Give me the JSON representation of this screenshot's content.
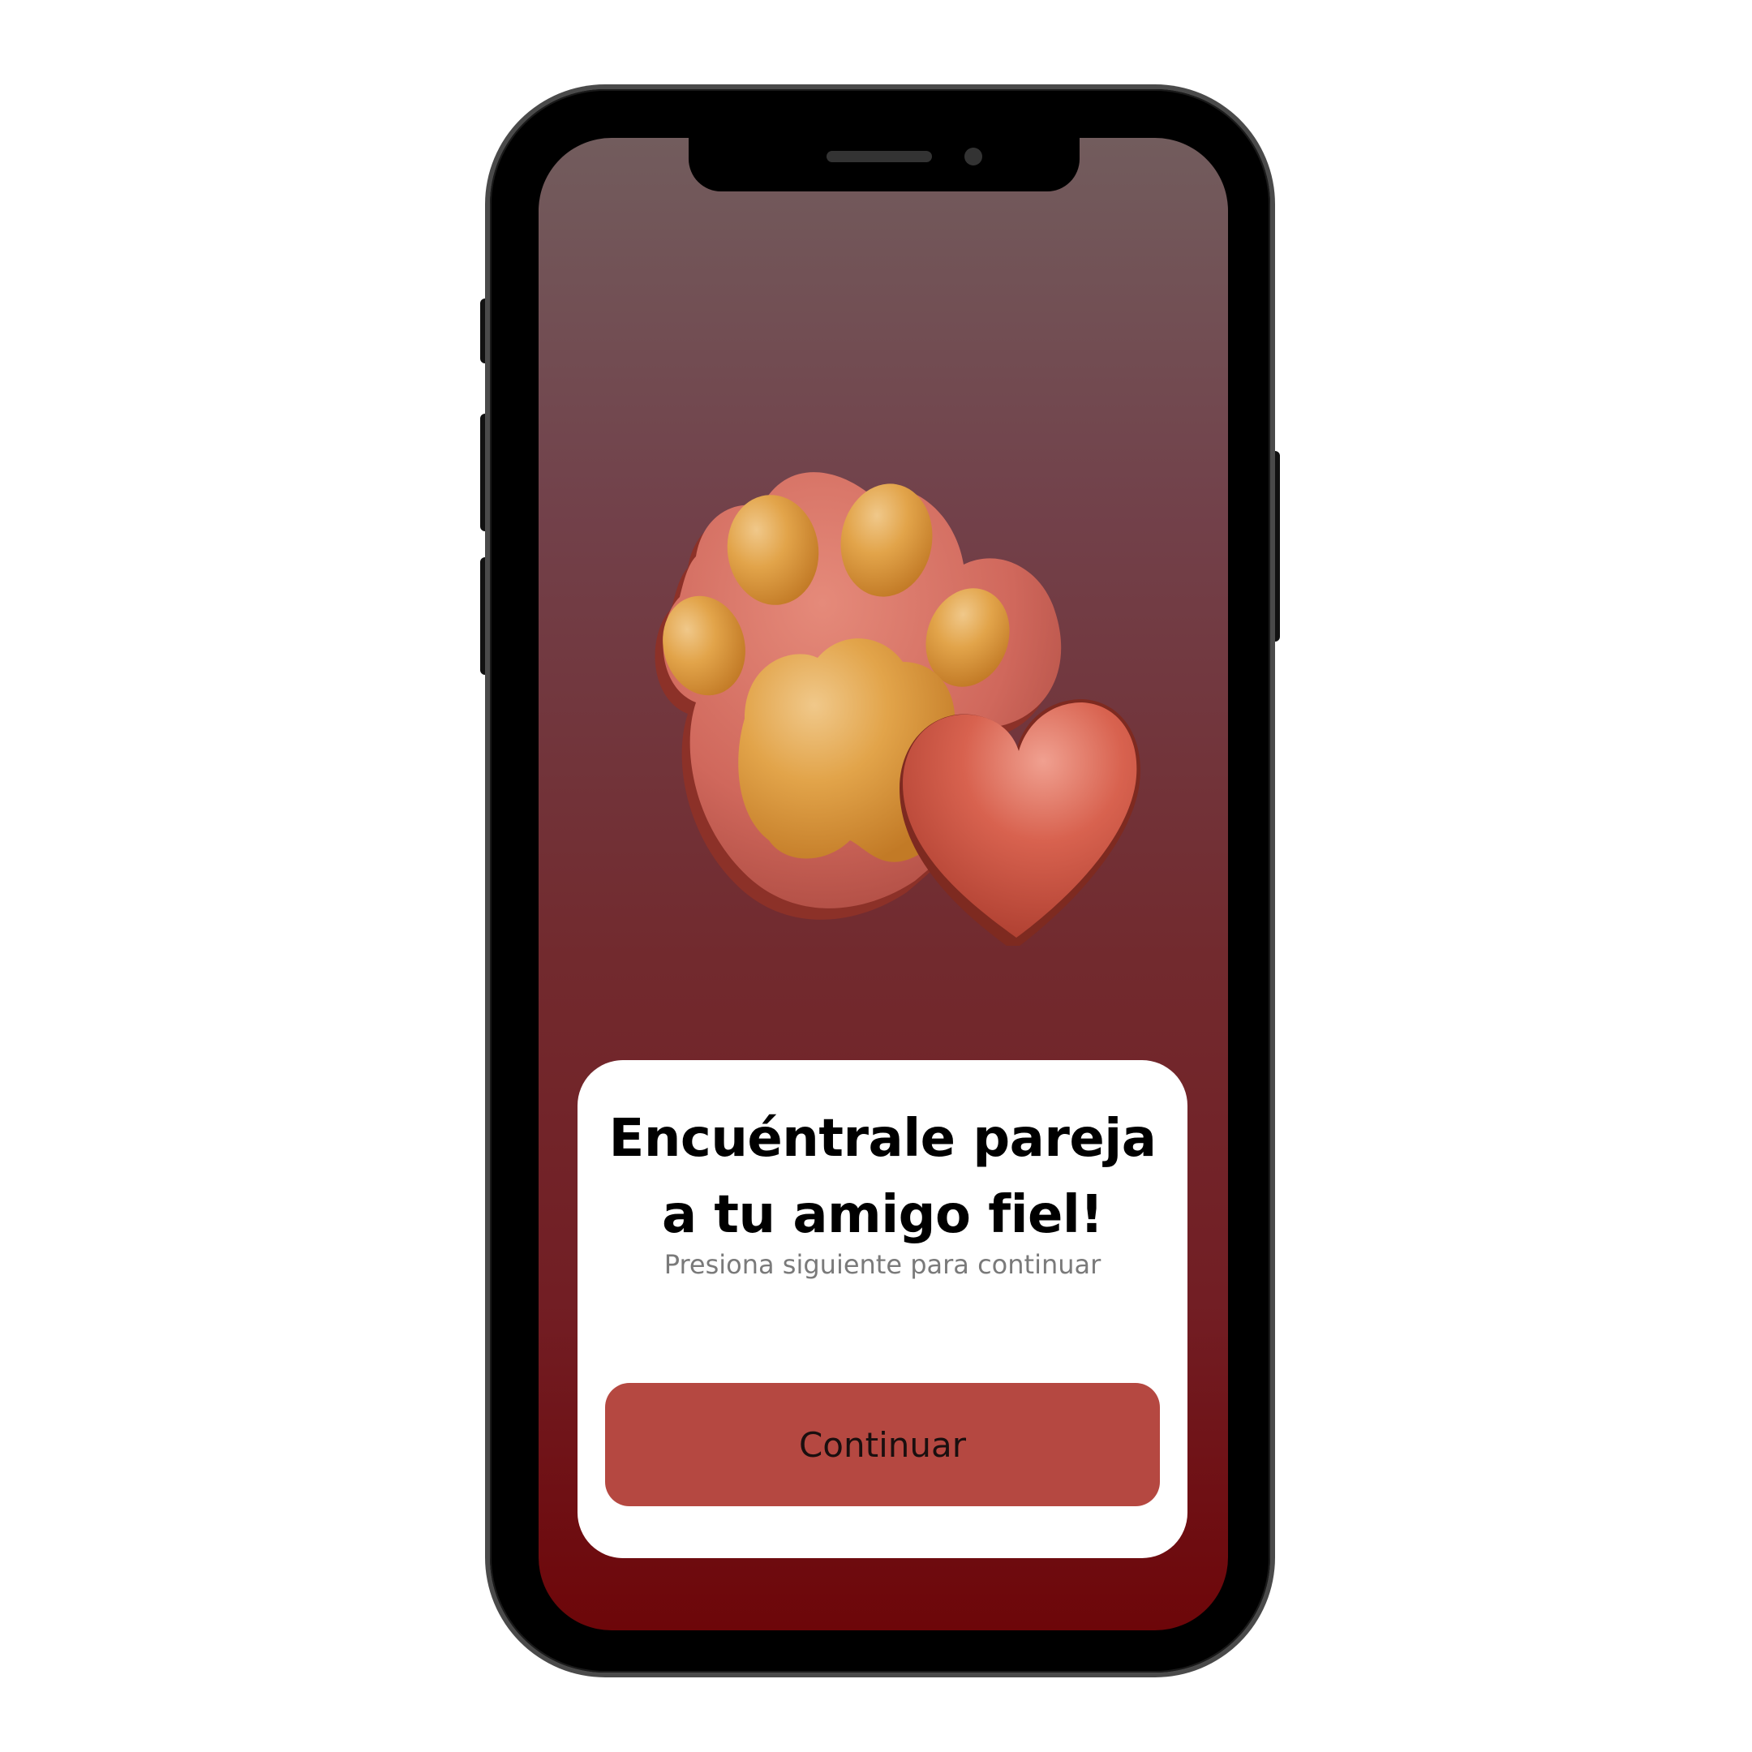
{
  "onboarding": {
    "title_line1": "Encuéntrale pareja",
    "title_line2": "a tu amigo fiel!",
    "subtitle": "Presiona siguiente para continuar",
    "continue_label": "Continuar"
  },
  "illustration": {
    "icon": "paw-with-heart-icon"
  },
  "colors": {
    "background_top": "#725c5d",
    "background_bottom": "#6d0609",
    "button": "#b54841",
    "paw_base": "#d0685c",
    "paw_pads": "#e0a040",
    "heart": "#d45a4a"
  }
}
